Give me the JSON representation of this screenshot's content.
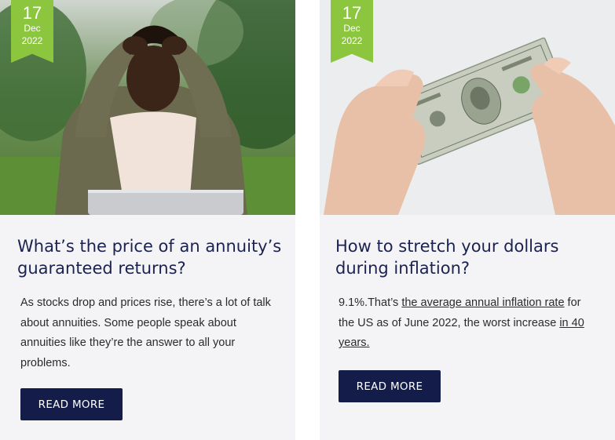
{
  "articles": [
    {
      "date": {
        "day": "17",
        "month": "Dec",
        "year": "2022"
      },
      "image_subject": "man-holding-head-at-laptop-photo",
      "title": "What’s the price of an annuity’s guaranteed returns?",
      "excerpt": "As stocks drop and prices rise, there’s a lot of talk about annuities. Some people speak about annuities like they’re the answer to all your problems.",
      "cta_label": "READ MORE"
    },
    {
      "date": {
        "day": "17",
        "month": "Dec",
        "year": "2022"
      },
      "image_subject": "hands-holding-dollar-bill-photo",
      "title": "How to stretch your dollars during inflation?",
      "excerpt": {
        "lead": "9.1%.That’s ",
        "link1": "the average annual inflation rate",
        "middle": " for the US as of June 2022, the worst increase ",
        "link2": "in 40 years.",
        "trail": ""
      },
      "cta_label": "READ MORE"
    }
  ],
  "colors": {
    "ribbon": "#8cc63f",
    "title": "#1b2250",
    "button": "#141d4a",
    "card_bg": "#f4f4f6"
  }
}
